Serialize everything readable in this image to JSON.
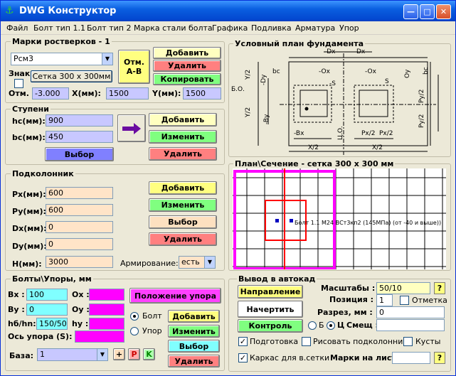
{
  "window": {
    "title": "DWG Конструктор",
    "icon": "app-icon"
  },
  "menu": [
    "Файл",
    "Болт тип 1.1",
    "Болт тип 2",
    "Марка стали болта",
    "Графика",
    "Подливка",
    "Арматура",
    "Упор"
  ],
  "marks": {
    "title": "Марки ростверков -  1",
    "select_value": "Рсм3",
    "otm_btn": "Отм.\nА-В",
    "add": "Добавить",
    "delete": "Удалить",
    "copy": "Копировать",
    "znak": "Знак",
    "grid_btn": "Сетка 300 х 300мм",
    "otm_label": "Отм.",
    "otm_value": "-3.000",
    "x_label": "X(мм):",
    "x_value": "1500",
    "y_label": "Y(мм):",
    "y_value": "1500"
  },
  "steps": {
    "title": "Ступени",
    "hc_label": "hc(мм):",
    "hc_value": "900",
    "bc_label": "bc(мм):",
    "bc_value": "450",
    "add": "Добавить",
    "change": "Изменить",
    "delete": "Удалить",
    "select": "Выбор"
  },
  "podkolonnik": {
    "title": "Подколонник",
    "px_label": "Px(мм):",
    "px_value": "600",
    "py_label": "Py(мм):",
    "py_value": "600",
    "dx_label": "Dx(мм):",
    "dx_value": "0",
    "dy_label": "Dy(мм):",
    "dy_value": "0",
    "h_label": "H(мм):",
    "h_value": "3000",
    "add": "Добавить",
    "change": "Изменить",
    "select": "Выбор",
    "delete": "Удалить",
    "arm_label": "Армирование:",
    "arm_value": "есть"
  },
  "bolts": {
    "title": "Болты\\Упоры, мм",
    "bx_label": "Bx :",
    "bx_value": "100",
    "ox_label": "Ox :",
    "by_label": "By :",
    "by_value": "0",
    "oy_label": "Oy :",
    "hb_label": "hб/hn:",
    "hb_value": "150/50",
    "hy_label": "hy :",
    "axis_label": "Ось упора (S):",
    "position_btn": "Положение упора",
    "radio_bolt": "Болт",
    "radio_upor": "Упор",
    "add": "Добавить",
    "change": "Изменить",
    "select": "Выбор",
    "delete": "Удалить",
    "base_label": "База:",
    "base_value": "1",
    "plus": "+",
    "p": "P",
    "k": "K"
  },
  "plan": {
    "title": "Условный план фундамента",
    "labels": {
      "dx_top": "-Dx",
      "dx_top2": "Dx",
      "bo": "Б.О.",
      "bc": "bc",
      "y2": "Y/2",
      "dy": "-Dy",
      "ox_neg": "-Ox",
      "ox": "Ox",
      "s_neg": "-S",
      "s": "S",
      "oy": "Oy",
      "by": "-By",
      "py2a": "Py/2",
      "py2b": "Py/2",
      "bx": "-Bx",
      "bx2": "Bx",
      "x2a": "X/2",
      "x2b": "X/2",
      "co": "Ц.О.",
      "px2a": "Px/2",
      "px2b": "Px/2"
    }
  },
  "section": {
    "title": "План\\Сечение - сетка 300 х 300 мм",
    "bolt_text": "Болт 1.1 М24 ВСт3кп2 (145МПа) (от -40 и выше))"
  },
  "output": {
    "title": "Вывод в автокад",
    "direction": "Направление",
    "draw": "Начертить",
    "control": "Контроль",
    "scale_label": "Масштабы :",
    "scale_value": "50/10",
    "position_label": "Позиция :",
    "position_value": "1",
    "mark_label": "Отметка",
    "cut_label": "Разрез, мм :",
    "cut_value": "0",
    "b_label": "Б",
    "c_label": "Ц",
    "smesh_label": "Смещ :",
    "podgotovka": "Подготовка",
    "draw_podkol": "Рисовать подколонник",
    "kusty": "Кусты",
    "karkas": "Каркас для в.сетки",
    "marks_label": "Марки на лист:",
    "help": "?"
  },
  "colors": {
    "accent": "#0a5fe0",
    "magenta": "#ff00ff",
    "red": "#ff0000"
  }
}
